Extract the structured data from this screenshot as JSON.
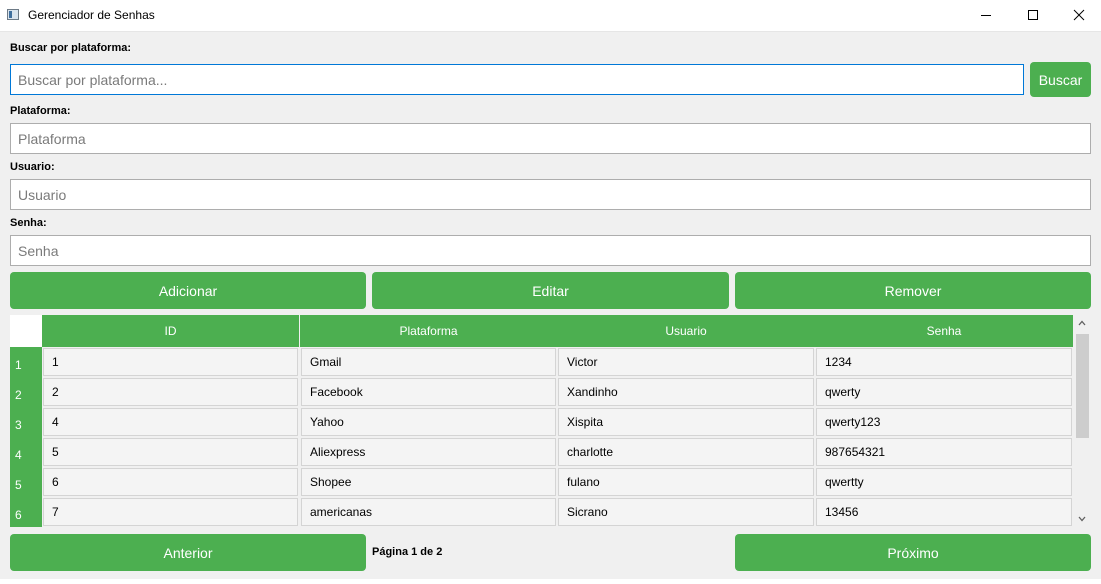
{
  "window": {
    "title": "Gerenciador de Senhas",
    "icon": "app-window-icon"
  },
  "search": {
    "label": "Buscar por plataforma:",
    "placeholder": "Buscar por plataforma...",
    "button_label": "Buscar"
  },
  "form": {
    "platform_label": "Plataforma:",
    "platform_placeholder": "Plataforma",
    "user_label": "Usuario:",
    "user_placeholder": "Usuario",
    "password_label": "Senha:",
    "password_placeholder": "Senha"
  },
  "actions": {
    "add_label": "Adicionar",
    "edit_label": "Editar",
    "remove_label": "Remover"
  },
  "table": {
    "columns": [
      "ID",
      "Plataforma",
      "Usuario",
      "Senha"
    ],
    "row_numbers": [
      "1",
      "2",
      "3",
      "4",
      "5",
      "6"
    ],
    "rows": [
      [
        "1",
        "Gmail",
        "Victor",
        "1234"
      ],
      [
        "2",
        "Facebook",
        "Xandinho",
        "qwerty"
      ],
      [
        "4",
        "Yahoo",
        "Xispita",
        "qwerty123"
      ],
      [
        "5",
        "Aliexpress",
        "charlotte",
        "987654321"
      ],
      [
        "6",
        "Shopee",
        "fulano",
        "qwertty"
      ],
      [
        "7",
        "americanas",
        "Sicrano",
        "13456"
      ]
    ]
  },
  "pagination": {
    "prev_label": "Anterior",
    "page_text": "Página 1 de 2",
    "next_label": "Próximo"
  },
  "colors": {
    "accent": "#4caf50",
    "background": "#f0f0f0",
    "focus_border": "#0078d7"
  }
}
